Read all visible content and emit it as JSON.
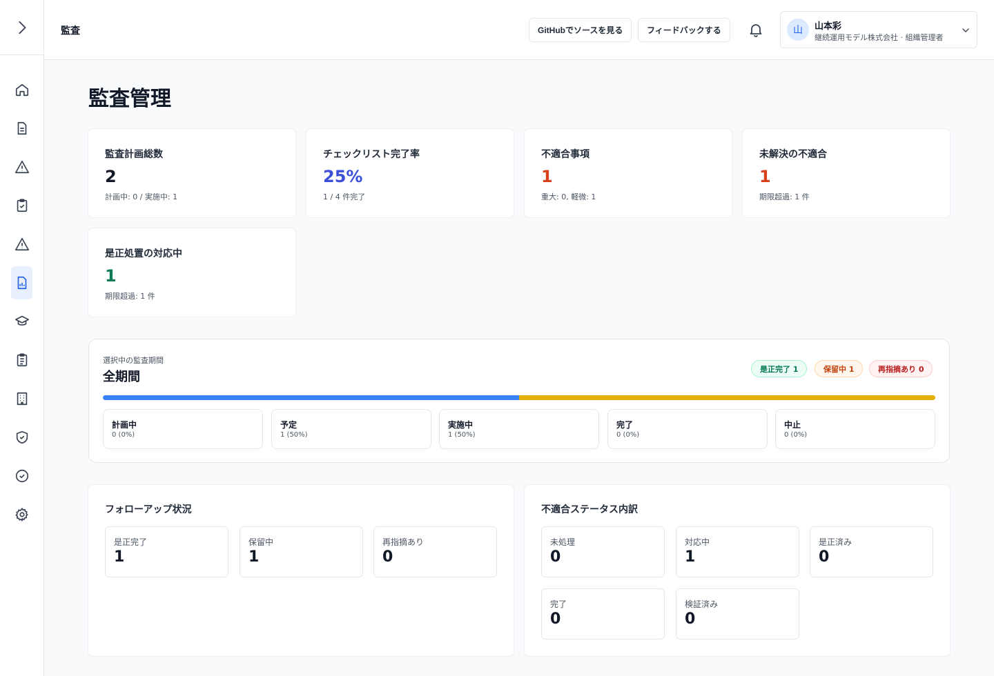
{
  "header": {
    "title": "監査",
    "github_button": "GitHubでソースを見る",
    "feedback_button": "フィードバックする",
    "user": {
      "avatar": "山",
      "name": "山本彩",
      "org": "継続運用モデル株式会社 · 組織管理者"
    }
  },
  "page": {
    "title": "監査管理"
  },
  "stats": [
    {
      "label": "監査計画総数",
      "value": "2",
      "sub": "計画中: 0 / 実施中: 1",
      "color": "#111827"
    },
    {
      "label": "チェックリスト完了率",
      "value": "25%",
      "sub": "1 / 4 件完了",
      "color": "#3b4fd8"
    },
    {
      "label": "不適合事項",
      "value": "1",
      "sub": "重大: 0, 軽微: 1",
      "color": "#d9401c"
    },
    {
      "label": "未解決の不適合",
      "value": "1",
      "sub": "期限超過: 1 件",
      "color": "#d9401c"
    },
    {
      "label": "是正処置の対応中",
      "value": "1",
      "sub": "期限超過: 1 件",
      "color": "#0f7a55"
    }
  ],
  "period": {
    "caption": "選択中の監査期間",
    "name": "全期間",
    "pills": [
      {
        "label": "是正完了 1",
        "bg": "#ecfdf5",
        "fg": "#047857",
        "border": "#a7f3d0"
      },
      {
        "label": "保留中 1",
        "bg": "#fff7ed",
        "fg": "#c2410c",
        "border": "#fed7aa"
      },
      {
        "label": "再指摘あり 0",
        "bg": "#fef2f2",
        "fg": "#b91c1c",
        "border": "#fecaca"
      }
    ],
    "progress": [
      {
        "fraction": 0.5,
        "color": "#3b82f6"
      },
      {
        "fraction": 0.5,
        "color": "#e4b00a"
      }
    ],
    "statuses": [
      {
        "label": "計画中",
        "value": "0 (0%)"
      },
      {
        "label": "予定",
        "value": "1 (50%)"
      },
      {
        "label": "実施中",
        "value": "1 (50%)"
      },
      {
        "label": "完了",
        "value": "0 (0%)"
      },
      {
        "label": "中止",
        "value": "0 (0%)"
      }
    ]
  },
  "followup": {
    "title": "フォローアップ状況",
    "items": [
      {
        "label": "是正完了",
        "value": "1"
      },
      {
        "label": "保留中",
        "value": "1"
      },
      {
        "label": "再指摘あり",
        "value": "0"
      }
    ]
  },
  "nonconformity": {
    "title": "不適合ステータス内訳",
    "items": [
      {
        "label": "未処理",
        "value": "0"
      },
      {
        "label": "対応中",
        "value": "1"
      },
      {
        "label": "是正済み",
        "value": "0"
      },
      {
        "label": "完了",
        "value": "0"
      },
      {
        "label": "検証済み",
        "value": "0"
      }
    ]
  },
  "sidebar": {
    "active_index": 5,
    "icons": [
      "home-icon",
      "document-icon",
      "warning-icon",
      "clipboard-check-icon",
      "alert-triangle-icon",
      "report-chart-icon",
      "graduation-cap-icon",
      "clipboard-list-icon",
      "building-icon",
      "shield-check-icon",
      "check-circle-icon",
      "settings-icon"
    ]
  }
}
